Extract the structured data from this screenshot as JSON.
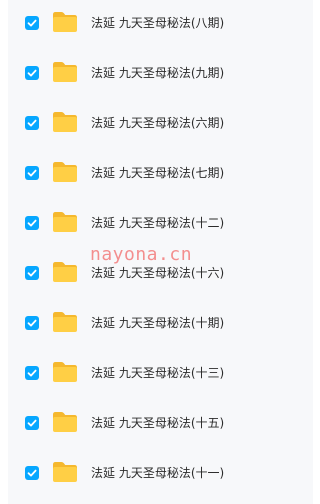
{
  "files": [
    {
      "name": "法延 九天圣母秘法(八期)",
      "checked": true,
      "icon": "folder-icon"
    },
    {
      "name": "法延 九天圣母秘法(九期)",
      "checked": true,
      "icon": "folder-icon"
    },
    {
      "name": "法延 九天圣母秘法(六期)",
      "checked": true,
      "icon": "folder-icon"
    },
    {
      "name": "法延 九天圣母秘法(七期)",
      "checked": true,
      "icon": "folder-icon"
    },
    {
      "name": "法延 九天圣母秘法(十二)",
      "checked": true,
      "icon": "folder-icon"
    },
    {
      "name": "法延 九天圣母秘法(十六)",
      "checked": true,
      "icon": "folder-icon"
    },
    {
      "name": "法延 九天圣母秘法(十期)",
      "checked": true,
      "icon": "folder-icon"
    },
    {
      "name": "法延 九天圣母秘法(十三)",
      "checked": true,
      "icon": "folder-icon"
    },
    {
      "name": "法延 九天圣母秘法(十五)",
      "checked": true,
      "icon": "folder-icon"
    },
    {
      "name": "法延 九天圣母秘法(十一)",
      "checked": true,
      "icon": "folder-icon"
    }
  ],
  "watermark": "nayona.cn",
  "colors": {
    "checkbox": "#06a7ff",
    "folder": "#ffc93d",
    "watermark": "#f26b6b"
  }
}
